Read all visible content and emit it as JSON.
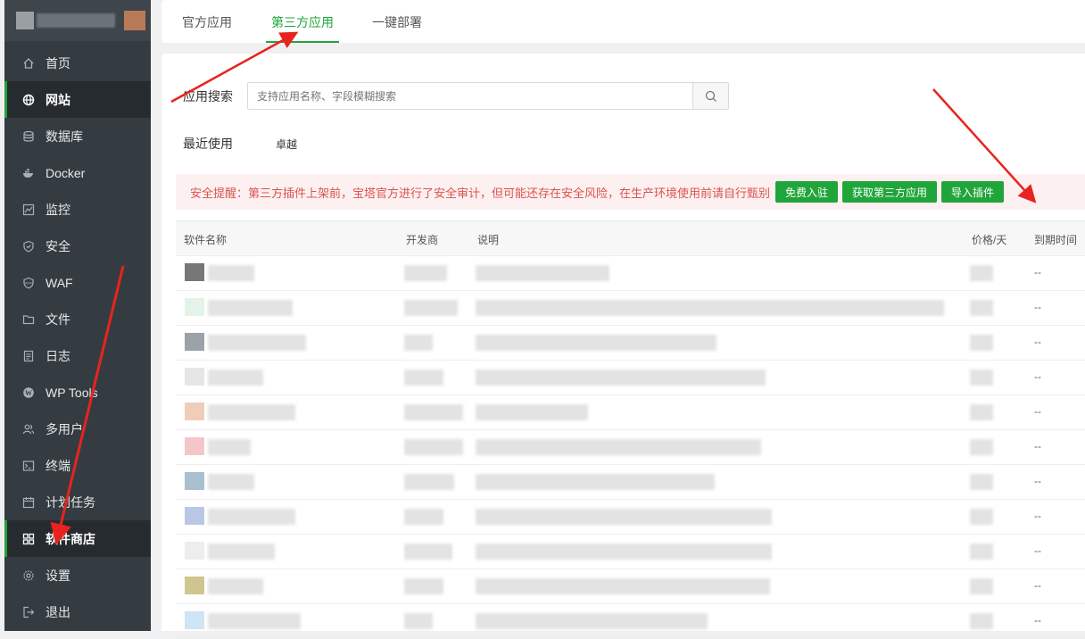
{
  "sidebar": {
    "items": [
      {
        "label": "首页",
        "icon": "home-icon",
        "active": false
      },
      {
        "label": "网站",
        "icon": "globe-icon",
        "active": true
      },
      {
        "label": "数据库",
        "icon": "database-icon",
        "active": false
      },
      {
        "label": "Docker",
        "icon": "docker-icon",
        "active": false
      },
      {
        "label": "监控",
        "icon": "monitor-chart-icon",
        "active": false
      },
      {
        "label": "安全",
        "icon": "shield-icon",
        "active": false
      },
      {
        "label": "WAF",
        "icon": "waf-shield-icon",
        "active": false
      },
      {
        "label": "文件",
        "icon": "folder-icon",
        "active": false
      },
      {
        "label": "日志",
        "icon": "log-icon",
        "active": false
      },
      {
        "label": "WP Tools",
        "icon": "wordpress-icon",
        "active": false
      },
      {
        "label": "多用户",
        "icon": "users-icon",
        "active": false
      },
      {
        "label": "终端",
        "icon": "terminal-icon",
        "active": false
      },
      {
        "label": "计划任务",
        "icon": "calendar-icon",
        "active": false
      },
      {
        "label": "软件商店",
        "icon": "app-grid-icon",
        "active": true
      },
      {
        "label": "设置",
        "icon": "gear-icon",
        "active": false
      },
      {
        "label": "退出",
        "icon": "logout-icon",
        "active": false
      }
    ]
  },
  "tabs": [
    {
      "label": "官方应用",
      "active": false
    },
    {
      "label": "第三方应用",
      "active": true
    },
    {
      "label": "一键部署",
      "active": false
    }
  ],
  "search": {
    "label": "应用搜索",
    "placeholder": "支持应用名称、字段模糊搜索"
  },
  "recent": {
    "label": "最近使用",
    "item": "卓越"
  },
  "alert": {
    "text": "安全提醒：第三方插件上架前，宝塔官方进行了安全审计，但可能还存在安全风险，在生产环境使用前请自行甄别",
    "buttons": [
      "免费入驻",
      "获取第三方应用",
      "导入插件"
    ]
  },
  "table": {
    "headers": [
      "软件名称",
      "开发商",
      "说明",
      "价格/天",
      "到期时间"
    ],
    "rows": [
      {
        "icon_color": "#777777",
        "expiry": "--"
      },
      {
        "icon_color": "#e4f3e8",
        "expiry": "--"
      },
      {
        "icon_color": "#9aa2aa",
        "expiry": "--"
      },
      {
        "icon_color": "#e6e6e6",
        "expiry": "--"
      },
      {
        "icon_color": "#efcdb8",
        "expiry": "--"
      },
      {
        "icon_color": "#f5c6c8",
        "expiry": "--"
      },
      {
        "icon_color": "#a8bfcf",
        "expiry": "--"
      },
      {
        "icon_color": "#b9c6e6",
        "expiry": "--"
      },
      {
        "icon_color": "#ededed",
        "expiry": "--"
      },
      {
        "icon_color": "#cfc58f",
        "expiry": "--"
      },
      {
        "icon_color": "#cfe4f4",
        "expiry": "--"
      }
    ]
  },
  "colors": {
    "accent": "#20a53a",
    "sidebar_bg": "#343c42",
    "alert_text": "#d9534f",
    "alert_bg": "#fdf0f0",
    "annotation_arrow": "#e8231f"
  }
}
